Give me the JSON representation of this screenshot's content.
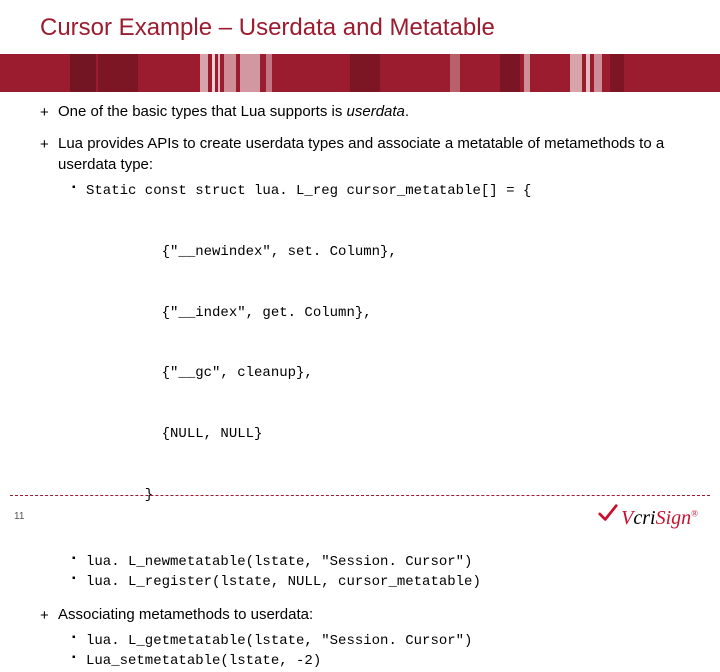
{
  "title": "Cursor Example – Userdata and Metatable",
  "bullets": {
    "b1_pre": "One of the basic types that Lua supports is ",
    "b1_em": "userdata",
    "b1_post": ".",
    "b2": "Lua provides APIs to create userdata types and associate a metatable of metamethods to a userdata type:",
    "b3": "Associating metamethods to userdata:"
  },
  "code1": {
    "l1": "Static const struct lua. L_reg cursor_metatable[] = {",
    "l2": "         {\"__newindex\", set. Column},",
    "l3": "         {\"__index\", get. Column},",
    "l4": "         {\"__gc\", cleanup},",
    "l5": "         {NULL, NULL}",
    "l6": "       }",
    "l7": "lua. L_newmetatable(lstate, \"Session. Cursor\")",
    "l8": "lua. L_register(lstate, NULL, cursor_metatable)"
  },
  "code2": {
    "l1": "lua. L_getmetatable(lstate, \"Session. Cursor\")",
    "l2": "Lua_setmetatable(lstate, -2)"
  },
  "page": "11",
  "logo": {
    "v": "V",
    "cri": "cri",
    "sign": "Sign",
    "reg": "®"
  }
}
